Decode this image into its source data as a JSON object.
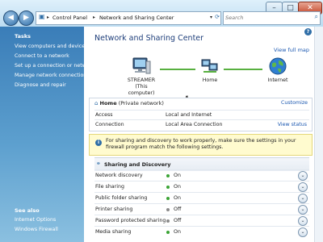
{
  "titlebar": {
    "buttons": {
      "minimize": "–",
      "maximize": "□",
      "close": "✕"
    }
  },
  "address": {
    "crumbs": [
      "Control Panel",
      "Network and Sharing Center"
    ]
  },
  "search": {
    "placeholder": "Search"
  },
  "sidebar": {
    "tasks_header": "Tasks",
    "tasks": [
      "View computers and devices",
      "Connect to a network",
      "Set up a connection or network",
      "Manage network connections",
      "Diagnose and repair"
    ],
    "see_also_header": "See also",
    "see_also": [
      "Internet Options",
      "Windows Firewall"
    ]
  },
  "main": {
    "title": "Network and Sharing Center",
    "view_full_map": "View full map",
    "map": {
      "computer": {
        "name": "STREAMER",
        "sub": "(This computer)"
      },
      "home": {
        "name": "Home"
      },
      "internet": {
        "name": "Internet"
      }
    },
    "network": {
      "name": "Home",
      "type": "(Private network)",
      "customize": "Customize",
      "rows": [
        {
          "label": "Access",
          "value": "Local and Internet",
          "link": ""
        },
        {
          "label": "Connection",
          "value": "Local Area Connection",
          "link": "View status"
        }
      ]
    },
    "info": "For sharing and discovery to work properly, make sure the settings in your firewall program match the following settings.",
    "sharing": {
      "header": "Sharing and Discovery",
      "rows": [
        {
          "label": "Network discovery",
          "state": "On",
          "color": "#3aa335"
        },
        {
          "label": "File sharing",
          "state": "On",
          "color": "#3aa335"
        },
        {
          "label": "Public folder sharing",
          "state": "On",
          "color": "#3aa335"
        },
        {
          "label": "Printer sharing",
          "state": "Off",
          "color": "#8a8a8a"
        },
        {
          "label": "Password protected sharing",
          "state": "Off",
          "color": "#8a8a8a"
        },
        {
          "label": "Media sharing",
          "state": "On",
          "color": "#3aa335"
        }
      ]
    }
  }
}
